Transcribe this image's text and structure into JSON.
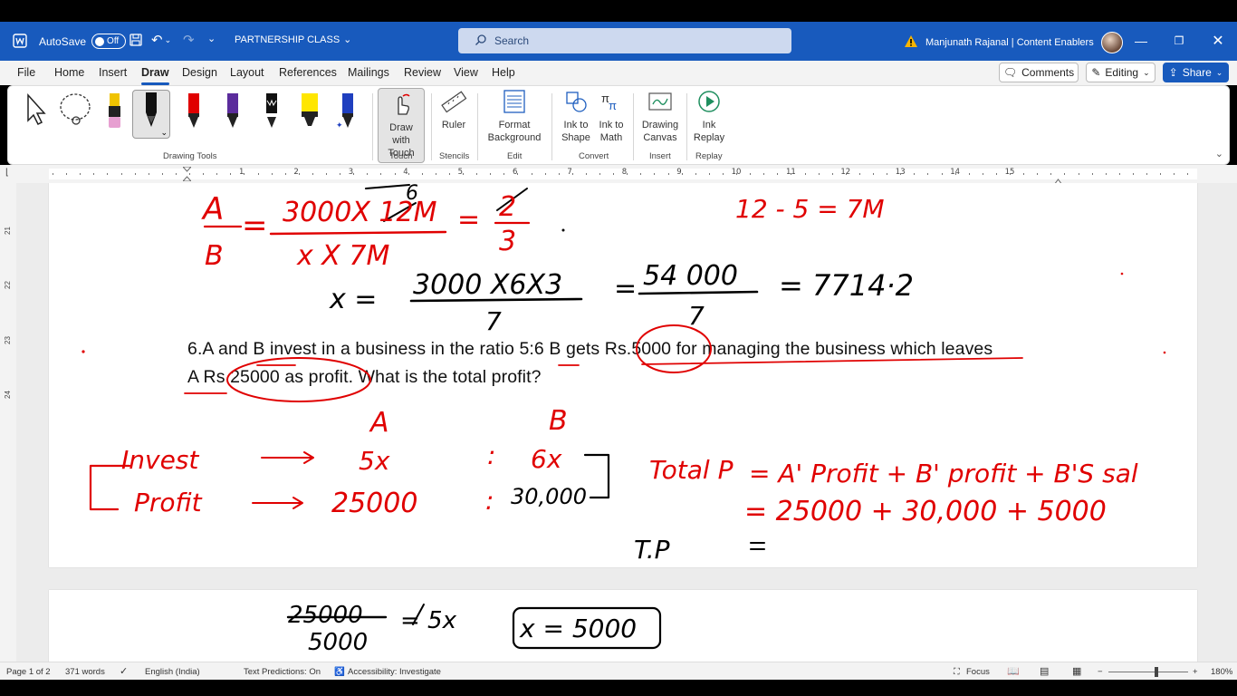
{
  "titlebar": {
    "autosave_label": "AutoSave",
    "autosave_state": "Off",
    "doc_title": "PARTNERSHIP CLASS",
    "search_placeholder": "Search",
    "user_name": "Manjunath Rajanal | Content Enablers"
  },
  "menu": {
    "tabs": [
      "File",
      "Home",
      "Insert",
      "Draw",
      "Design",
      "Layout",
      "References",
      "Mailings",
      "Review",
      "View",
      "Help"
    ],
    "active": "Draw",
    "comments": "Comments",
    "editing": "Editing",
    "share": "Share"
  },
  "ribbon": {
    "drawing_tools_label": "Drawing Tools",
    "draw_with_touch": "Draw with Touch",
    "touch_label": "Touch",
    "ruler": "Ruler",
    "stencils_label": "Stencils",
    "format_background": "Format Background",
    "edit_label": "Edit",
    "ink_to_shape": "Ink to Shape",
    "ink_to_math": "Ink to Math",
    "convert_label": "Convert",
    "drawing_canvas": "Drawing Canvas",
    "insert_label": "Insert",
    "ink_replay": "Ink Replay",
    "replay_label": "Replay",
    "pen_colors": [
      "#000000",
      "#e00000",
      "#5b2c9c",
      "#000000",
      "#ffe600",
      "#1f3fbf"
    ]
  },
  "ruler": {
    "h_numbers": [
      "1",
      "2",
      "3",
      "4",
      "5",
      "6",
      "7",
      "8",
      "9",
      "10",
      "11",
      "12",
      "13",
      "14",
      "15"
    ],
    "v_numbers": [
      "21",
      "22",
      "23",
      "24"
    ]
  },
  "document": {
    "question_line1": "6.A and B invest in a business in the ratio 5:6 B gets Rs.5000 for managing the business which leaves",
    "question_line2": "A Rs 25000 as profit. What is the total profit?",
    "ink": {
      "ratio_lhs_top": "A",
      "ratio_lhs_bottom": "B",
      "ratio_num": "3000X 12M",
      "ratio_num_fix": "6",
      "ratio_den": "x X 7M",
      "ratio_rhs_top": "2",
      "ratio_rhs_bottom": "3",
      "months": "12 - 5 = 7M",
      "x_eq_lhs": "x =",
      "x_num": "3000 X6X3",
      "x_den": "7",
      "x_mid_num": "54 000",
      "x_mid_den": "7",
      "x_result": "= 7714·2",
      "col_a": "A",
      "col_b": "B",
      "row_invest": "Invest",
      "row_profit": "Profit",
      "invest_a": "5x",
      "invest_b": "6x",
      "profit_a": "25000",
      "profit_b": "30,000",
      "total_lhs": "Total P",
      "total_formula": "= A' Profit + B' profit + B'S sal",
      "total_values": "= 25000 + 30,000 + 5000",
      "tp_label": "T.P",
      "tp_eq": "=",
      "p2_top": "25000",
      "p2_bottom": "5000",
      "p2_eq": "= 5x",
      "p2_box": "x = 5000"
    }
  },
  "status": {
    "page": "Page 1 of 2",
    "words": "371 words",
    "language": "English (India)",
    "text_predictions": "Text Predictions: On",
    "accessibility": "Accessibility: Investigate",
    "focus": "Focus",
    "zoom": "180%"
  }
}
